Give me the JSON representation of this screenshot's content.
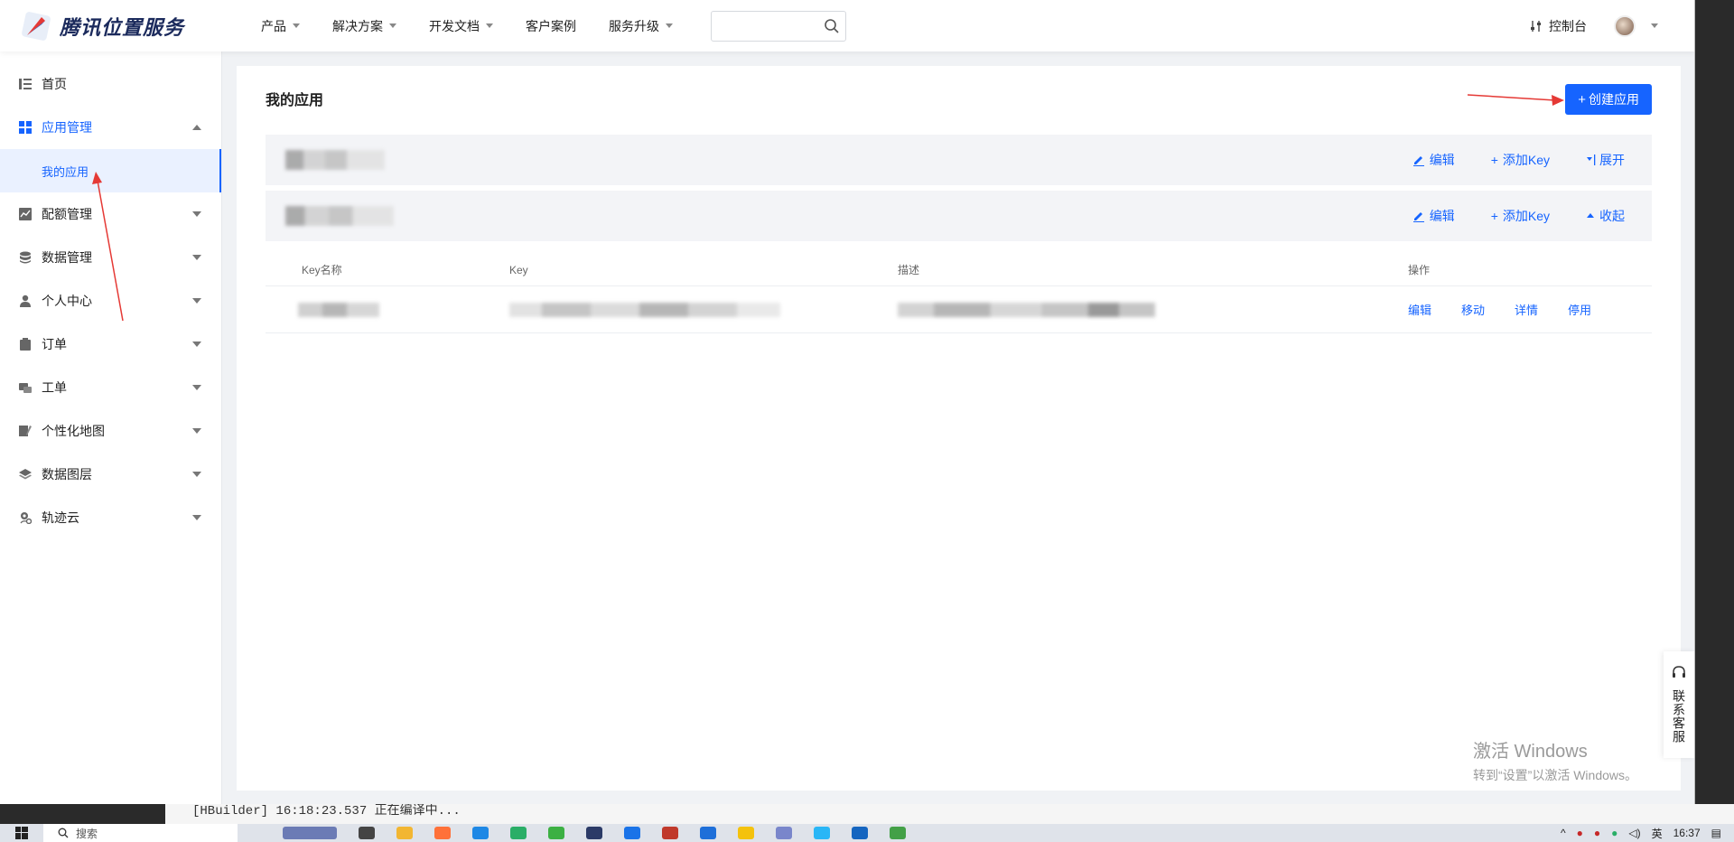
{
  "header": {
    "logo_text": "腾讯位置服务",
    "nav": [
      "产品",
      "解决方案",
      "开发文档",
      "客户案例",
      "服务升级"
    ],
    "nav_has_caret": [
      true,
      true,
      true,
      false,
      true
    ],
    "search_placeholder": "",
    "console_label": "控制台"
  },
  "sidebar": {
    "items": [
      {
        "label": "首页",
        "icon": "list-icon"
      },
      {
        "label": "应用管理",
        "icon": "grid-icon"
      },
      {
        "label": "配额管理",
        "icon": "chart-icon"
      },
      {
        "label": "数据管理",
        "icon": "database-icon"
      },
      {
        "label": "个人中心",
        "icon": "user-icon"
      },
      {
        "label": "订单",
        "icon": "clipboard-icon"
      },
      {
        "label": "工单",
        "icon": "ticket-icon"
      },
      {
        "label": "个性化地图",
        "icon": "map-style-icon"
      },
      {
        "label": "数据图层",
        "icon": "layers-icon"
      },
      {
        "label": "轨迹云",
        "icon": "track-cloud-icon"
      }
    ],
    "sub_items": [
      {
        "label": "我的应用"
      }
    ]
  },
  "main": {
    "title": "我的应用",
    "create_button": "创建应用",
    "app_rows": [
      {
        "actions": [
          "编辑",
          "添加Key",
          "展开"
        ],
        "expanded": false
      },
      {
        "actions": [
          "编辑",
          "添加Key",
          "收起"
        ],
        "expanded": true
      }
    ],
    "table": {
      "headers": [
        "Key名称",
        "Key",
        "描述",
        "操作"
      ],
      "row_ops": [
        "编辑",
        "移动",
        "详情",
        "停用"
      ]
    }
  },
  "support": {
    "label": "联系客服"
  },
  "watermark": {
    "line1": "激活 Windows",
    "line2": "转到“设置”以激活 Windows。"
  },
  "background_console": {
    "line": "[HBuilder] 16:18:23.537 正在编译中..."
  },
  "taskbar": {
    "search_label": "搜索",
    "ime": "英",
    "time": "16:37"
  },
  "colors": {
    "accent": "#1664ff",
    "annotation": "#e53935"
  }
}
